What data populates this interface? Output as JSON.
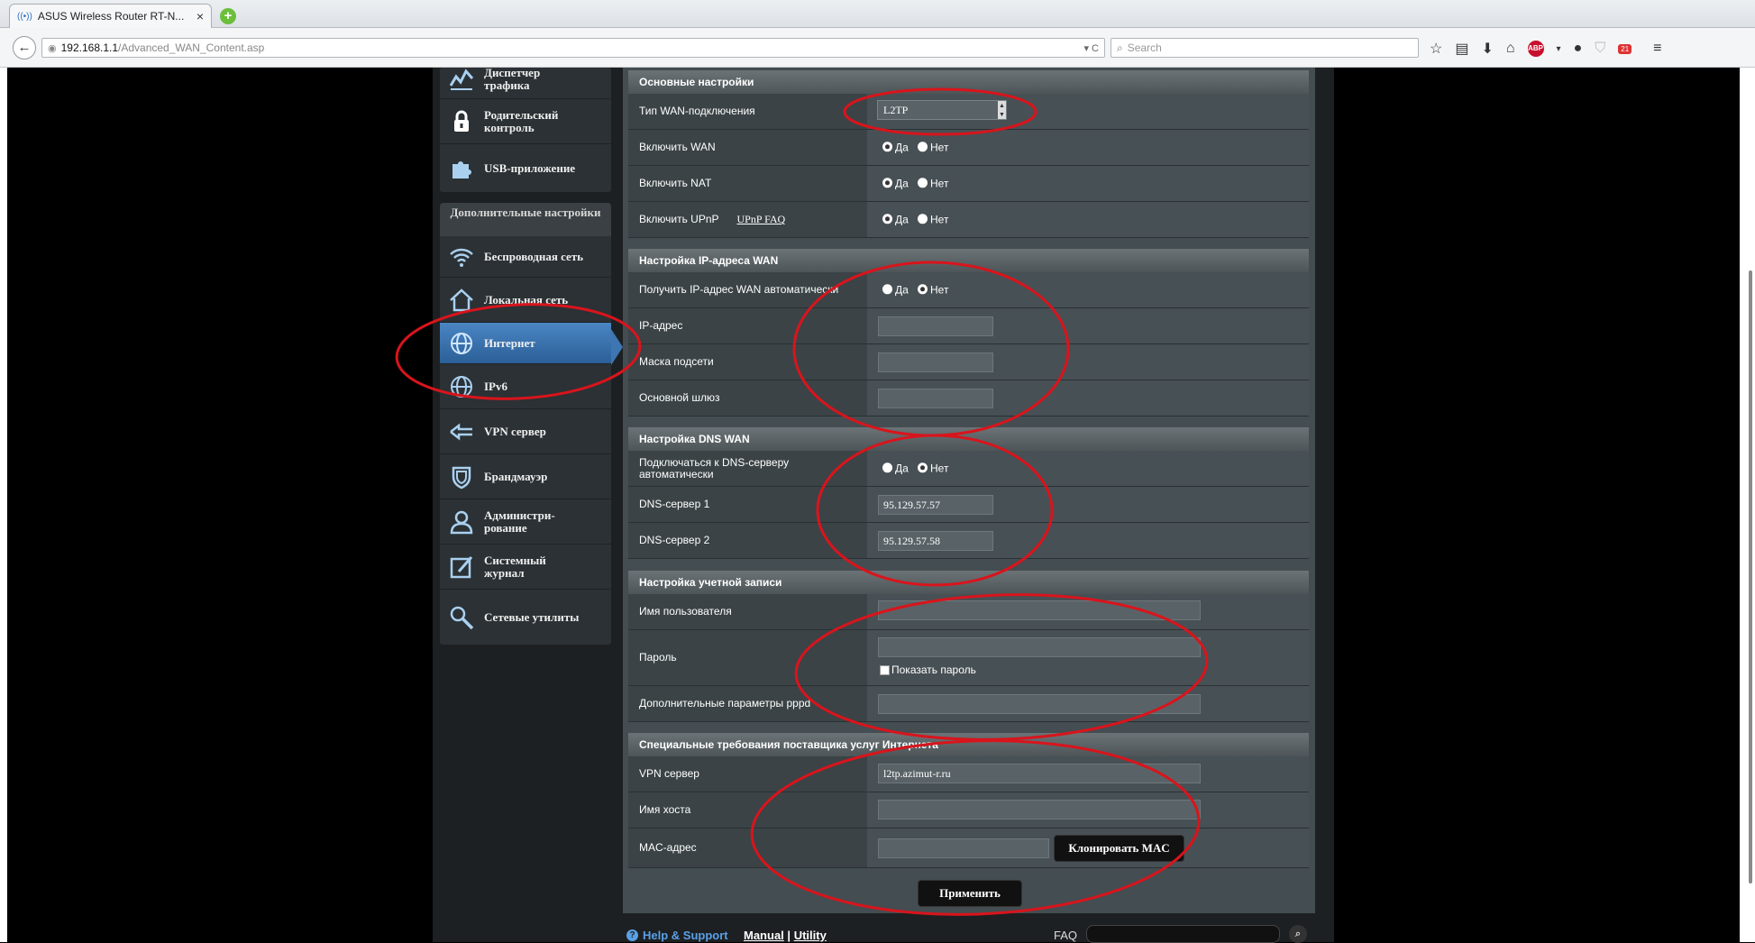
{
  "browser": {
    "tab_title": "ASUS Wireless Router RT-N...",
    "url_host": "192.168.1.1",
    "url_path": "/Advanced_WAN_Content.asp",
    "search_placeholder": "Search"
  },
  "menu": {
    "top_items": [
      {
        "label": "Диспетчер трафика",
        "icon": "traffic-manager-icon"
      },
      {
        "label": "Родительский контроль",
        "icon": "lock-icon"
      },
      {
        "label": "USB-приложение",
        "icon": "puzzle-icon"
      }
    ],
    "advanced_heading": "Дополнительные настройки",
    "advanced_items": [
      {
        "label": "Беспроводная сеть",
        "icon": "wifi-icon"
      },
      {
        "label": "Локальная сеть",
        "icon": "home-icon"
      },
      {
        "label": "Интернет",
        "icon": "globe-icon"
      },
      {
        "label": "IPv6",
        "icon": "globe-ipv6-icon"
      },
      {
        "label": "VPN сервер",
        "icon": "vpn-icon"
      },
      {
        "label": "Брандмауэр",
        "icon": "shield-icon"
      },
      {
        "label": "Администри-рование",
        "icon": "person-icon"
      },
      {
        "label": "Системный журнал",
        "icon": "log-edit-icon"
      },
      {
        "label": "Сетевые утилиты",
        "icon": "tools-icon"
      }
    ]
  },
  "radio": {
    "yes": "Да",
    "no": "Нет"
  },
  "basic": {
    "heading": "Основные настройки",
    "wan_type_label": "Тип WAN-подключения",
    "wan_type_value": "L2TP",
    "enable_wan_label": "Включить WAN",
    "enable_nat_label": "Включить NAT",
    "enable_upnp_label": "Включить UPnP",
    "upnp_faq": "UPnP FAQ"
  },
  "ip": {
    "heading": "Настройка IP-адреса WAN",
    "auto_label": "Получить IP-адрес WAN автоматически",
    "ip_label": "IP-адрес",
    "mask_label": "Маска подсети",
    "gateway_label": "Основной шлюз"
  },
  "dns": {
    "heading": "Настройка DNS WAN",
    "auto_label": "Подключаться к DNS-серверу автоматически",
    "dns1_label": "DNS-сервер 1",
    "dns1_value": "95.129.57.57",
    "dns2_label": "DNS-сервер 2",
    "dns2_value": "95.129.57.58"
  },
  "account": {
    "heading": "Настройка учетной записи",
    "username_label": "Имя пользователя",
    "password_label": "Пароль",
    "show_password": "Показать пароль",
    "pppd_label": "Дополнительные параметры pppd"
  },
  "isp": {
    "heading": "Специальные требования поставщика услуг Интернета",
    "vpn_label": "VPN сервер",
    "vpn_value": "l2tp.azimut-r.ru",
    "host_label": "Имя хоста",
    "mac_label": "MAC-адрес",
    "clone_mac": "Клонировать MAC"
  },
  "apply_button": "Применить",
  "footer": {
    "help": "Help & Support",
    "manual": "Manual",
    "separator": "|",
    "utility": "Utility",
    "faq": "FAQ"
  },
  "colors": {
    "annotation": "#d9141c",
    "active_menu": "#3d76b2",
    "help_link": "#5aa0e6"
  }
}
